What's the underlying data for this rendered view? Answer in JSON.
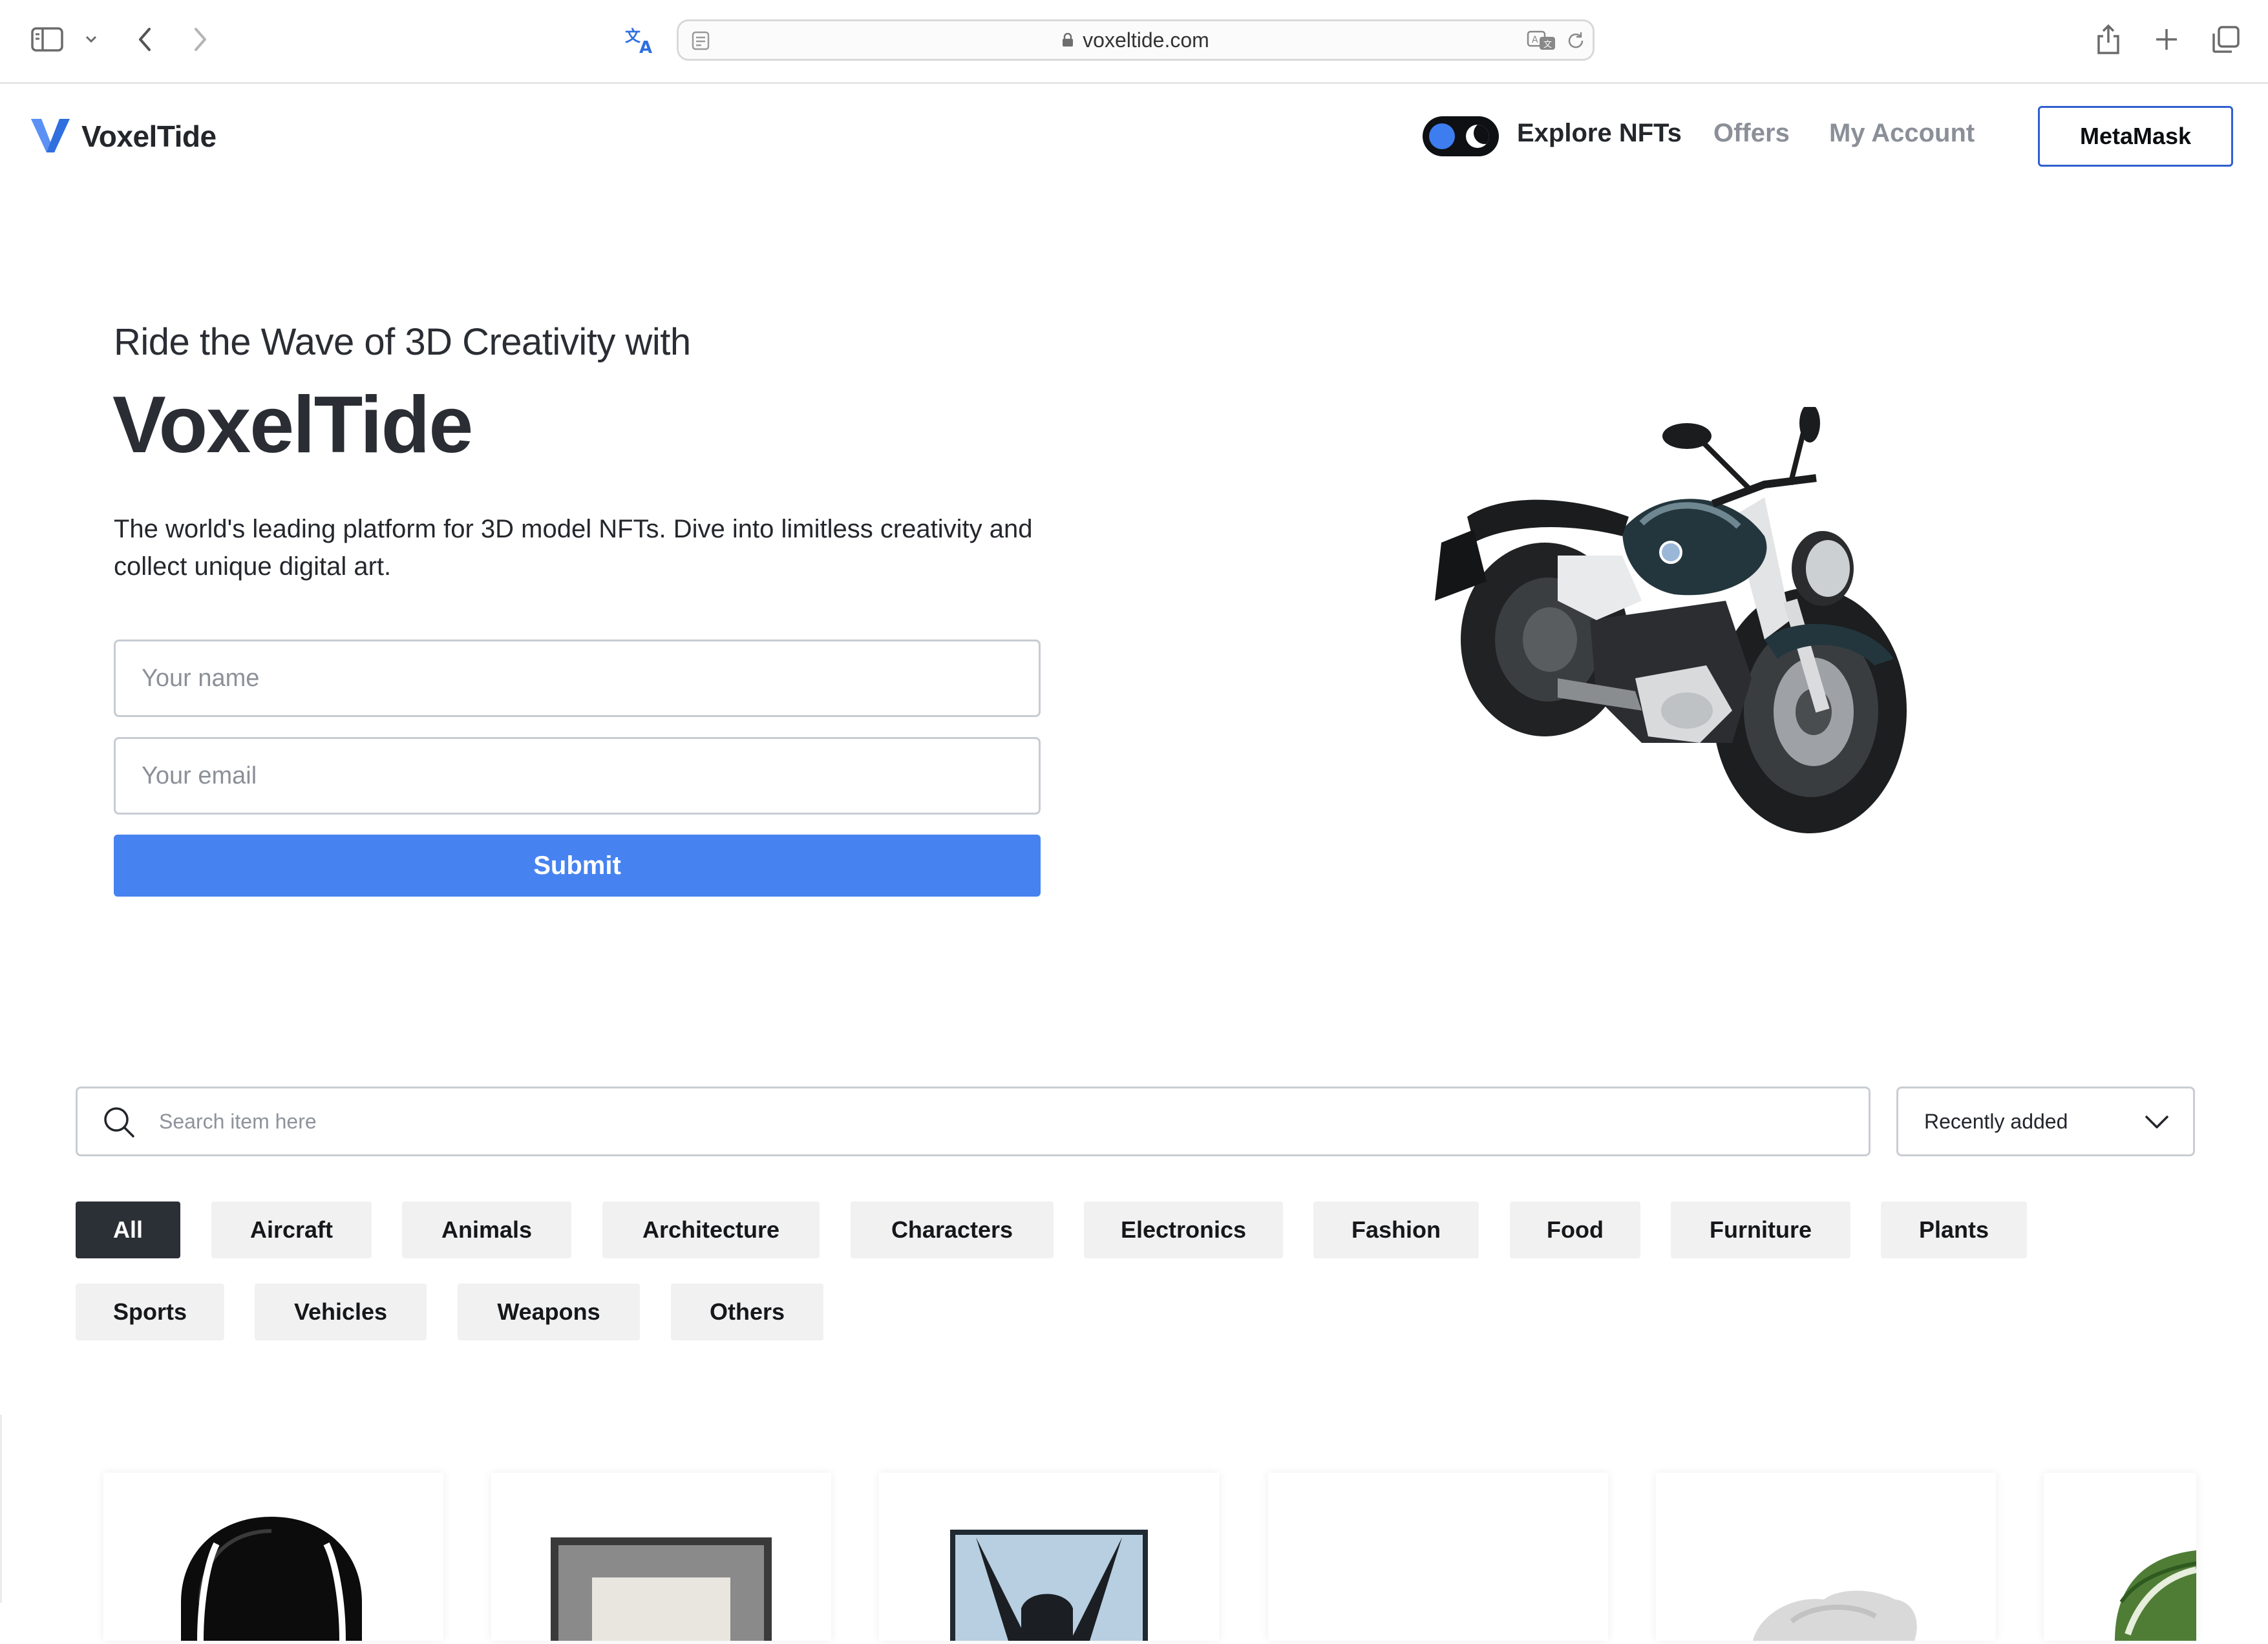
{
  "browser": {
    "url": "voxeltide.com"
  },
  "site": {
    "brand": "VoxelTide",
    "nav": {
      "explore": "Explore NFTs",
      "offers": "Offers",
      "account": "My Account",
      "wallet_button": "MetaMask"
    }
  },
  "hero": {
    "subtitle": "Ride the Wave of 3D Creativity with",
    "title": "VoxelTide",
    "description": "The world's leading platform for 3D model NFTs. Dive into limitless creativity and collect unique digital art.",
    "name_placeholder": "Your name",
    "email_placeholder": "Your email",
    "submit_label": "Submit"
  },
  "filters": {
    "search_placeholder": "Search item here",
    "sort_selected": "Recently added",
    "categories": [
      "All",
      "Aircraft",
      "Animals",
      "Architecture",
      "Characters",
      "Electronics",
      "Fashion",
      "Food",
      "Furniture",
      "Plants",
      "Sports",
      "Vehicles",
      "Weapons",
      "Others"
    ],
    "active_category": "All"
  },
  "colors": {
    "accent_blue": "#4783f0",
    "dark": "#2b2f36",
    "chip_bg": "#f1f1f1",
    "muted_nav": "#8a8f98"
  },
  "icons": [
    "sidebar-icon",
    "chevron-down-icon",
    "back-icon",
    "forward-icon",
    "translate-icon",
    "reader-icon",
    "lock-icon",
    "translate-badge-icon",
    "reload-icon",
    "share-icon",
    "new-tab-icon",
    "tabs-icon",
    "voxeltide-logo-icon",
    "theme-toggle-icon",
    "search-icon",
    "dropdown-chevron-icon"
  ]
}
